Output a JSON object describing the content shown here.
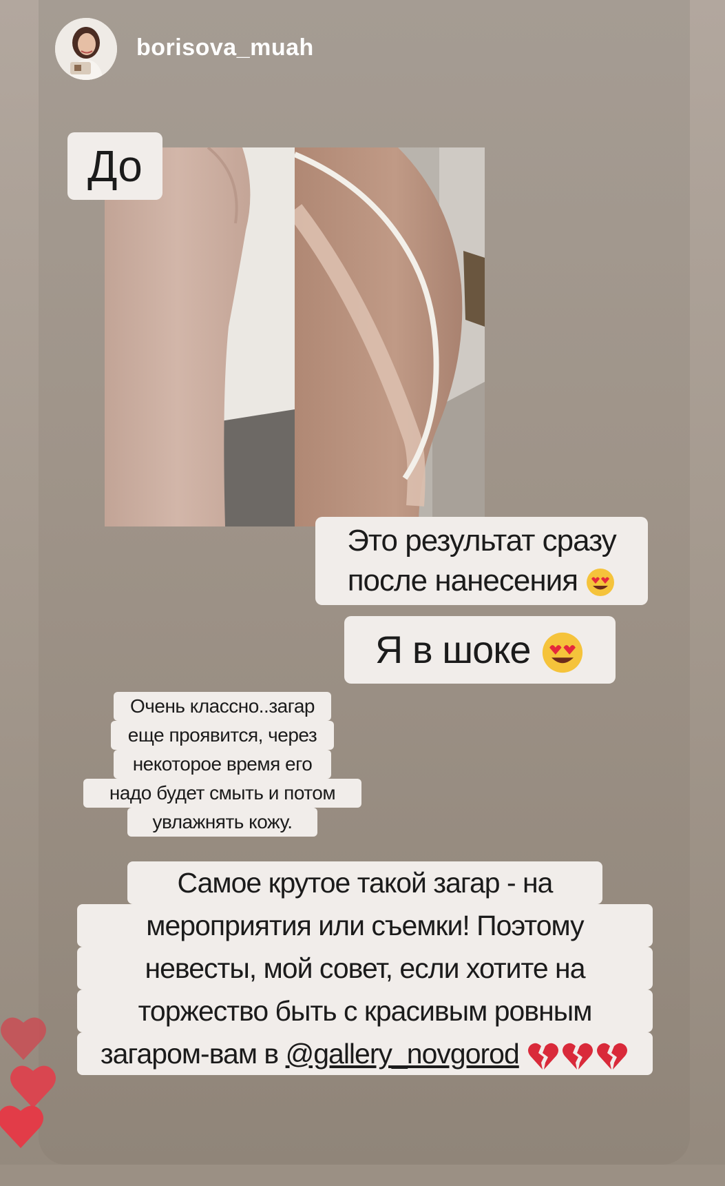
{
  "header": {
    "username": "borisova_muah",
    "avatar_icon": "avatar-photo-icon"
  },
  "photo": {
    "label_before": "До"
  },
  "stickers": {
    "result_line1": "Это результат сразу",
    "result_line2": "после нанесения",
    "shock": "Я в шоке",
    "note_lines": [
      "Очень классно..загар",
      "еще проявится, через",
      "некоторое время его",
      "надо будет смыть и потом",
      "увлажнять кожу."
    ],
    "advice_lines": [
      "Самое крутое такой загар - на",
      "мероприятия или съемки! Поэтому",
      "невесты, мой совет, если хотите на",
      "торжество быть с красивым ровным"
    ],
    "advice_last_prefix": "загаром-вам в ",
    "advice_mention": "@gallery_novgorod",
    "emoji": {
      "heart_eyes": "smiling-face-heart-eyes-icon",
      "broken_heart": "broken-heart-icon"
    }
  },
  "reactions": {
    "icon": "heart-icon",
    "colors": [
      "#c94e55",
      "#d94650",
      "#e23c48"
    ]
  }
}
